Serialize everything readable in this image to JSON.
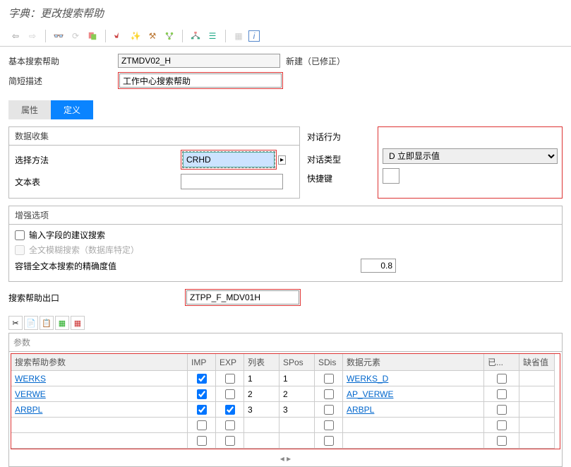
{
  "title": "字典：更改搜索帮助",
  "form": {
    "basic_label": "基本搜索帮助",
    "basic_value": "ZTMDV02_H",
    "status": "新建（已修正）",
    "desc_label": "简短描述",
    "desc_value": "工作中心搜索帮助"
  },
  "tabs": {
    "attr": "属性",
    "def": "定义"
  },
  "data_collect": {
    "header": "数据收集",
    "select_method_label": "选择方法",
    "select_method_value": "CRHD",
    "text_table_label": "文本表"
  },
  "dialog": {
    "header": "对话行为",
    "type_label": "对话类型",
    "type_value": "D 立即显示值",
    "hotkey_label": "快捷键"
  },
  "enhance": {
    "header": "增强选项",
    "suggest": "输入字段的建议搜索",
    "fuzzy": "全文模糊搜索（数据库特定）",
    "tolerance_label": "容错全文本搜索的精确度值",
    "tolerance_value": "0.8"
  },
  "exit": {
    "label": "搜索帮助出口",
    "value": "ZTPP_F_MDV01H"
  },
  "table": {
    "section": "参数",
    "cols": {
      "param": "搜索帮助参数",
      "imp": "IMP",
      "exp": "EXP",
      "list": "列表",
      "spos": "SPos",
      "sdis": "SDis",
      "elem": "数据元素",
      "mod": "已...",
      "default": "缺省值"
    },
    "rows": [
      {
        "param": "WERKS",
        "imp": true,
        "exp": false,
        "list": "1",
        "spos": "1",
        "sdis": false,
        "elem": "WERKS_D",
        "mod": false
      },
      {
        "param": "VERWE",
        "imp": true,
        "exp": false,
        "list": "2",
        "spos": "2",
        "sdis": false,
        "elem": "AP_VERWE",
        "mod": false
      },
      {
        "param": "ARBPL",
        "imp": true,
        "exp": true,
        "list": "3",
        "spos": "3",
        "sdis": false,
        "elem": "ARBPL",
        "mod": false
      }
    ]
  }
}
